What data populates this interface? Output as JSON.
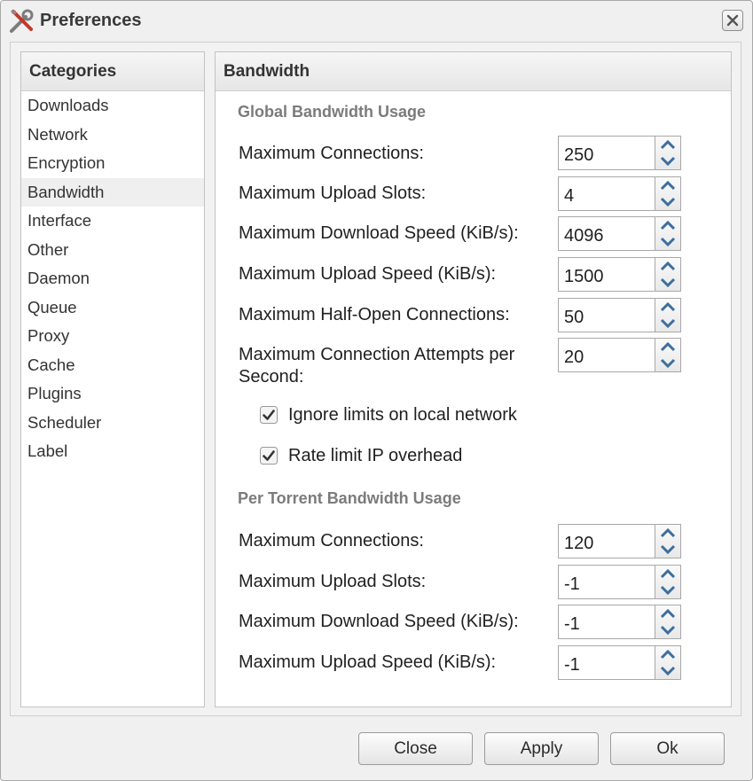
{
  "window": {
    "title": "Preferences",
    "icon": "tools-icon",
    "close_icon": "close-icon"
  },
  "categories": {
    "header": "Categories",
    "selected": "Bandwidth",
    "items": [
      {
        "label": "Downloads"
      },
      {
        "label": "Network"
      },
      {
        "label": "Encryption"
      },
      {
        "label": "Bandwidth"
      },
      {
        "label": "Interface"
      },
      {
        "label": "Other"
      },
      {
        "label": "Daemon"
      },
      {
        "label": "Queue"
      },
      {
        "label": "Proxy"
      },
      {
        "label": "Cache"
      },
      {
        "label": "Plugins"
      },
      {
        "label": "Scheduler"
      },
      {
        "label": "Label"
      }
    ]
  },
  "bandwidth": {
    "header": "Bandwidth",
    "global": {
      "title": "Global Bandwidth Usage",
      "rows": [
        {
          "label": "Maximum Connections:",
          "value": "250"
        },
        {
          "label": "Maximum Upload Slots:",
          "value": "4"
        },
        {
          "label": "Maximum Download Speed (KiB/s):",
          "value": "4096"
        },
        {
          "label": "Maximum Upload Speed (KiB/s):",
          "value": "1500"
        },
        {
          "label": "Maximum Half-Open Connections:",
          "value": "50"
        },
        {
          "label": "Maximum Connection Attempts per Second:",
          "value": "20"
        }
      ],
      "checkboxes": [
        {
          "label": "Ignore limits on local network",
          "checked": true
        },
        {
          "label": "Rate limit IP overhead",
          "checked": true
        }
      ]
    },
    "per_torrent": {
      "title": "Per Torrent Bandwidth Usage",
      "rows": [
        {
          "label": "Maximum Connections:",
          "value": "120"
        },
        {
          "label": "Maximum Upload Slots:",
          "value": "-1"
        },
        {
          "label": "Maximum Download Speed (KiB/s):",
          "value": "-1"
        },
        {
          "label": "Maximum Upload Speed (KiB/s):",
          "value": "-1"
        }
      ]
    }
  },
  "buttons": {
    "close": "Close",
    "apply": "Apply",
    "ok": "Ok"
  },
  "colors": {
    "accent_arrow": "#3c6ea0",
    "section_title": "#7b7b7b",
    "selected_row": "#efefef"
  }
}
